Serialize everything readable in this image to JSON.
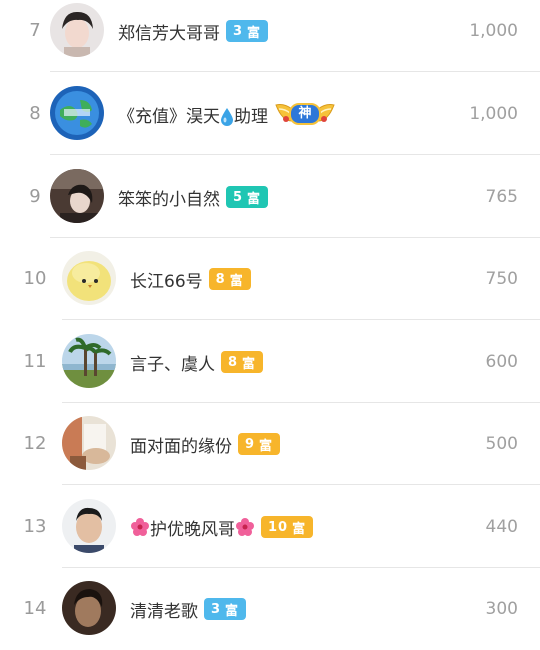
{
  "rows": [
    {
      "rank": "7",
      "name": "郑信芳大哥哥",
      "badge": {
        "level": "3",
        "label": "富",
        "color": "#4fb8ec"
      },
      "score": "1,000",
      "avatar_icon": "user-avatar-woman"
    },
    {
      "rank": "8",
      "name_parts": [
        "《充值》淏天",
        "助理"
      ],
      "special_badge": "神",
      "score": "1,000",
      "avatar_icon": "user-avatar-globe"
    },
    {
      "rank": "9",
      "name": "笨笨的小自然",
      "badge": {
        "level": "5",
        "label": "富",
        "color": "#1fc6b3"
      },
      "score": "765",
      "avatar_icon": "user-avatar-person"
    },
    {
      "rank": "10",
      "name": "长江66号",
      "badge": {
        "level": "8",
        "label": "富",
        "color": "#f7b52b"
      },
      "score": "750",
      "avatar_icon": "user-avatar-chick"
    },
    {
      "rank": "11",
      "name": "言子、虞人",
      "badge": {
        "level": "8",
        "label": "富",
        "color": "#f7b52b"
      },
      "score": "600",
      "avatar_icon": "user-avatar-palm-trees"
    },
    {
      "rank": "12",
      "name": "面对面的缘份",
      "badge": {
        "level": "9",
        "label": "富",
        "color": "#f7b52b"
      },
      "score": "500",
      "avatar_icon": "user-avatar-room"
    },
    {
      "rank": "13",
      "name": "护优晚风哥",
      "badge": {
        "level": "10",
        "label": "富",
        "color": "#f7b52b"
      },
      "score": "440",
      "avatar_icon": "user-avatar-man"
    },
    {
      "rank": "14",
      "name": "清清老歌",
      "badge": {
        "level": "3",
        "label": "富",
        "color": "#4fb8ec"
      },
      "score": "300",
      "avatar_icon": "user-avatar-dark"
    }
  ]
}
